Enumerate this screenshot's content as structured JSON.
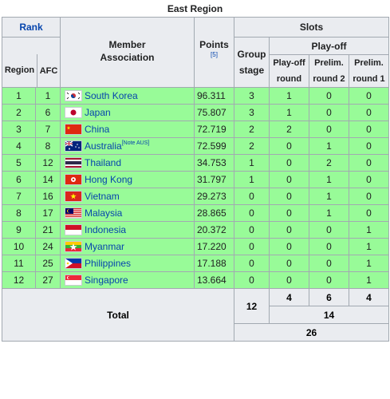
{
  "caption": "East Region",
  "headers": {
    "rank": "Rank",
    "region": "Region",
    "afc": "AFC",
    "member_line1": "Member",
    "member_line2": "Association",
    "points": "Points",
    "points_ref": "[5]",
    "slots": "Slots",
    "group_line1": "Group",
    "group_line2": "stage",
    "playoff": "Play-off",
    "playoff_round_line1": "Play-off",
    "playoff_round_line2": "round",
    "prelim2_line1": "Prelim.",
    "prelim2_line2": "round 2",
    "prelim1_line1": "Prelim.",
    "prelim1_line2": "round 1"
  },
  "rows": [
    {
      "region": "1",
      "afc": "1",
      "name": "South Korea",
      "note": "",
      "points": "96.311",
      "group": "3",
      "playoff": "1",
      "prelim2": "0",
      "prelim1": "0",
      "flag": "south-korea"
    },
    {
      "region": "2",
      "afc": "6",
      "name": "Japan",
      "note": "",
      "points": "75.807",
      "group": "3",
      "playoff": "1",
      "prelim2": "0",
      "prelim1": "0",
      "flag": "japan"
    },
    {
      "region": "3",
      "afc": "7",
      "name": "China",
      "note": "",
      "points": "72.719",
      "group": "2",
      "playoff": "2",
      "prelim2": "0",
      "prelim1": "0",
      "flag": "china"
    },
    {
      "region": "4",
      "afc": "8",
      "name": "Australia",
      "note": "[Note AUS]",
      "points": "72.599",
      "group": "2",
      "playoff": "0",
      "prelim2": "1",
      "prelim1": "0",
      "flag": "australia"
    },
    {
      "region": "5",
      "afc": "12",
      "name": "Thailand",
      "note": "",
      "points": "34.753",
      "group": "1",
      "playoff": "0",
      "prelim2": "2",
      "prelim1": "0",
      "flag": "thailand"
    },
    {
      "region": "6",
      "afc": "14",
      "name": "Hong Kong",
      "note": "",
      "points": "31.797",
      "group": "1",
      "playoff": "0",
      "prelim2": "1",
      "prelim1": "0",
      "flag": "hong-kong"
    },
    {
      "region": "7",
      "afc": "16",
      "name": "Vietnam",
      "note": "",
      "points": "29.273",
      "group": "0",
      "playoff": "0",
      "prelim2": "1",
      "prelim1": "0",
      "flag": "vietnam"
    },
    {
      "region": "8",
      "afc": "17",
      "name": "Malaysia",
      "note": "",
      "points": "28.865",
      "group": "0",
      "playoff": "0",
      "prelim2": "1",
      "prelim1": "0",
      "flag": "malaysia"
    },
    {
      "region": "9",
      "afc": "21",
      "name": "Indonesia",
      "note": "",
      "points": "20.372",
      "group": "0",
      "playoff": "0",
      "prelim2": "0",
      "prelim1": "1",
      "flag": "indonesia"
    },
    {
      "region": "10",
      "afc": "24",
      "name": "Myanmar",
      "note": "",
      "points": "17.220",
      "group": "0",
      "playoff": "0",
      "prelim2": "0",
      "prelim1": "1",
      "flag": "myanmar"
    },
    {
      "region": "11",
      "afc": "25",
      "name": "Philippines",
      "note": "",
      "points": "17.188",
      "group": "0",
      "playoff": "0",
      "prelim2": "0",
      "prelim1": "1",
      "flag": "philippines"
    },
    {
      "region": "12",
      "afc": "27",
      "name": "Singapore",
      "note": "",
      "points": "13.664",
      "group": "0",
      "playoff": "0",
      "prelim2": "0",
      "prelim1": "1",
      "flag": "singapore"
    }
  ],
  "total": {
    "label": "Total",
    "group": "12",
    "playoff": "4",
    "prelim2": "6",
    "prelim1": "4",
    "playoff_sum": "14",
    "grand": "26"
  },
  "colors": {
    "row_bg": "#98fb98",
    "header_bg": "#eaecf0",
    "link": "#0645ad",
    "border": "#a2a9b1"
  }
}
